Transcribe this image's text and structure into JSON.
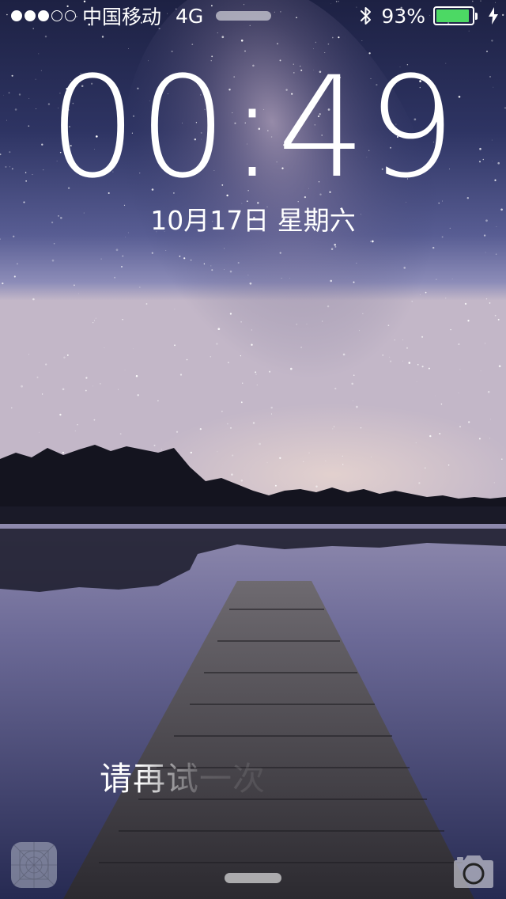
{
  "status_bar": {
    "signal_dots_filled": 3,
    "signal_dots_total": 5,
    "carrier": "中国移动",
    "network": "4G",
    "battery_percent": "93%",
    "battery_level": 0.93,
    "battery_color": "#4cd964",
    "icons": [
      "bluetooth-icon",
      "battery-icon",
      "charging-bolt-icon"
    ]
  },
  "lock_screen": {
    "time": "00:49",
    "date": "10月17日 星期六",
    "message": "请再试一次"
  },
  "bottom": {
    "left_icon": "control-center-icon",
    "right_icon": "camera-icon"
  }
}
